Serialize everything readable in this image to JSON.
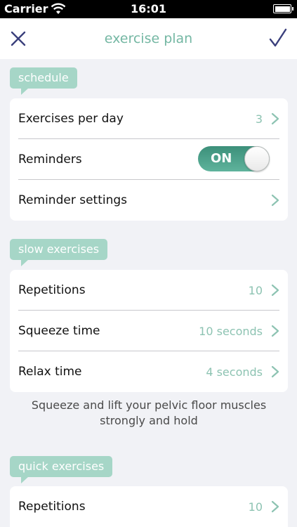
{
  "status_bar": {
    "carrier": "Carrier",
    "time": "16:01"
  },
  "nav": {
    "title": "exercise plan",
    "close_icon": "close-icon",
    "done_icon": "checkmark-icon"
  },
  "schedule": {
    "tag": "schedule",
    "exercises_per_day": {
      "label": "Exercises per day",
      "value": "3"
    },
    "reminders": {
      "label": "Reminders",
      "toggle": "ON"
    },
    "reminder_settings": {
      "label": "Reminder settings"
    }
  },
  "slow": {
    "tag": "slow exercises",
    "repetitions": {
      "label": "Repetitions",
      "value": "10"
    },
    "squeeze": {
      "label": "Squeeze time",
      "value": "10 seconds"
    },
    "relax": {
      "label": "Relax time",
      "value": "4 seconds"
    },
    "description": "Squeeze and lift your pelvic floor muscles strongly and hold"
  },
  "quick": {
    "tag": "quick exercises",
    "repetitions": {
      "label": "Repetitions",
      "value": "10"
    }
  },
  "colors": {
    "accent": "#74b7a3",
    "tag_bg": "#a6d6c7",
    "toggle_on": "#4ea38c",
    "background": "#f1f2f6"
  }
}
